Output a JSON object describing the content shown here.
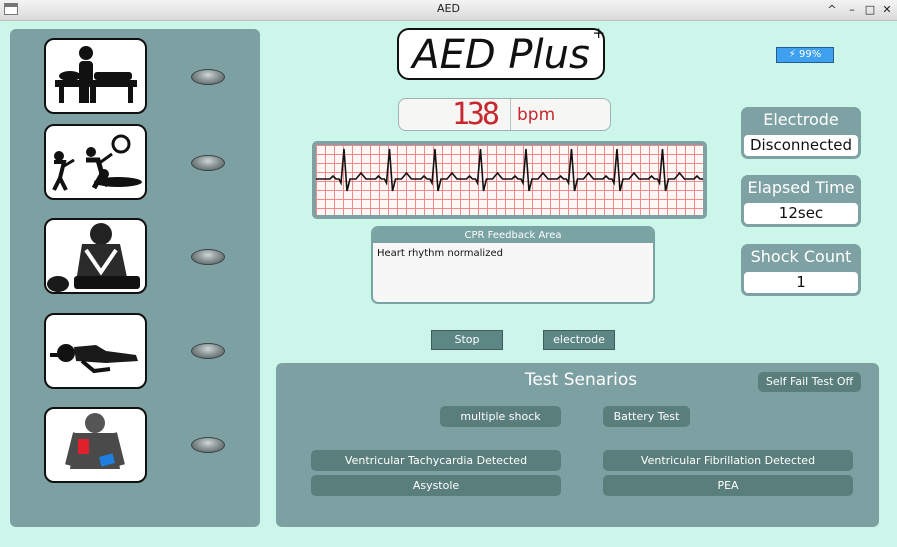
{
  "window": {
    "title": "AED",
    "controls": [
      "^",
      "–",
      "□",
      "✕"
    ]
  },
  "logo": {
    "text": "AED Plus",
    "superscript": "+"
  },
  "battery": {
    "label": "⚡ 99%"
  },
  "heart_rate": {
    "value": "138",
    "unit": "bpm"
  },
  "cpr_feedback": {
    "header": "CPR Feedback Area",
    "message": "Heart rhythm normalized"
  },
  "buttons": {
    "stop": "Stop",
    "electrode": "electrode"
  },
  "status": {
    "electrode": {
      "label": "Electrode",
      "value": "Disconnected"
    },
    "elapsed": {
      "label": "Elapsed Time",
      "value": "12sec"
    },
    "shocks": {
      "label": "Shock Count",
      "value": "1"
    }
  },
  "tests": {
    "title": "Test Senarios",
    "self_fail": "Self Fail Test Off",
    "multiple_shock": "multiple shock",
    "battery_test": "Battery Test",
    "vt": "Ventricular Tachycardia Detected",
    "vf": "Ventricular Fibrillation Detected",
    "asystole": "Asystole",
    "pea": "PEA"
  },
  "steps": [
    {
      "icon": "patient-lying-icon"
    },
    {
      "icon": "check-responsiveness-icon"
    },
    {
      "icon": "chest-compression-icon"
    },
    {
      "icon": "recovery-position-icon"
    },
    {
      "icon": "pad-placement-icon"
    }
  ],
  "colors": {
    "background": "#ccf6ea",
    "panel": "#7da0a3",
    "button": "#597e7c",
    "bpm_red": "#c6282e",
    "battery": "#3ea0ee"
  }
}
